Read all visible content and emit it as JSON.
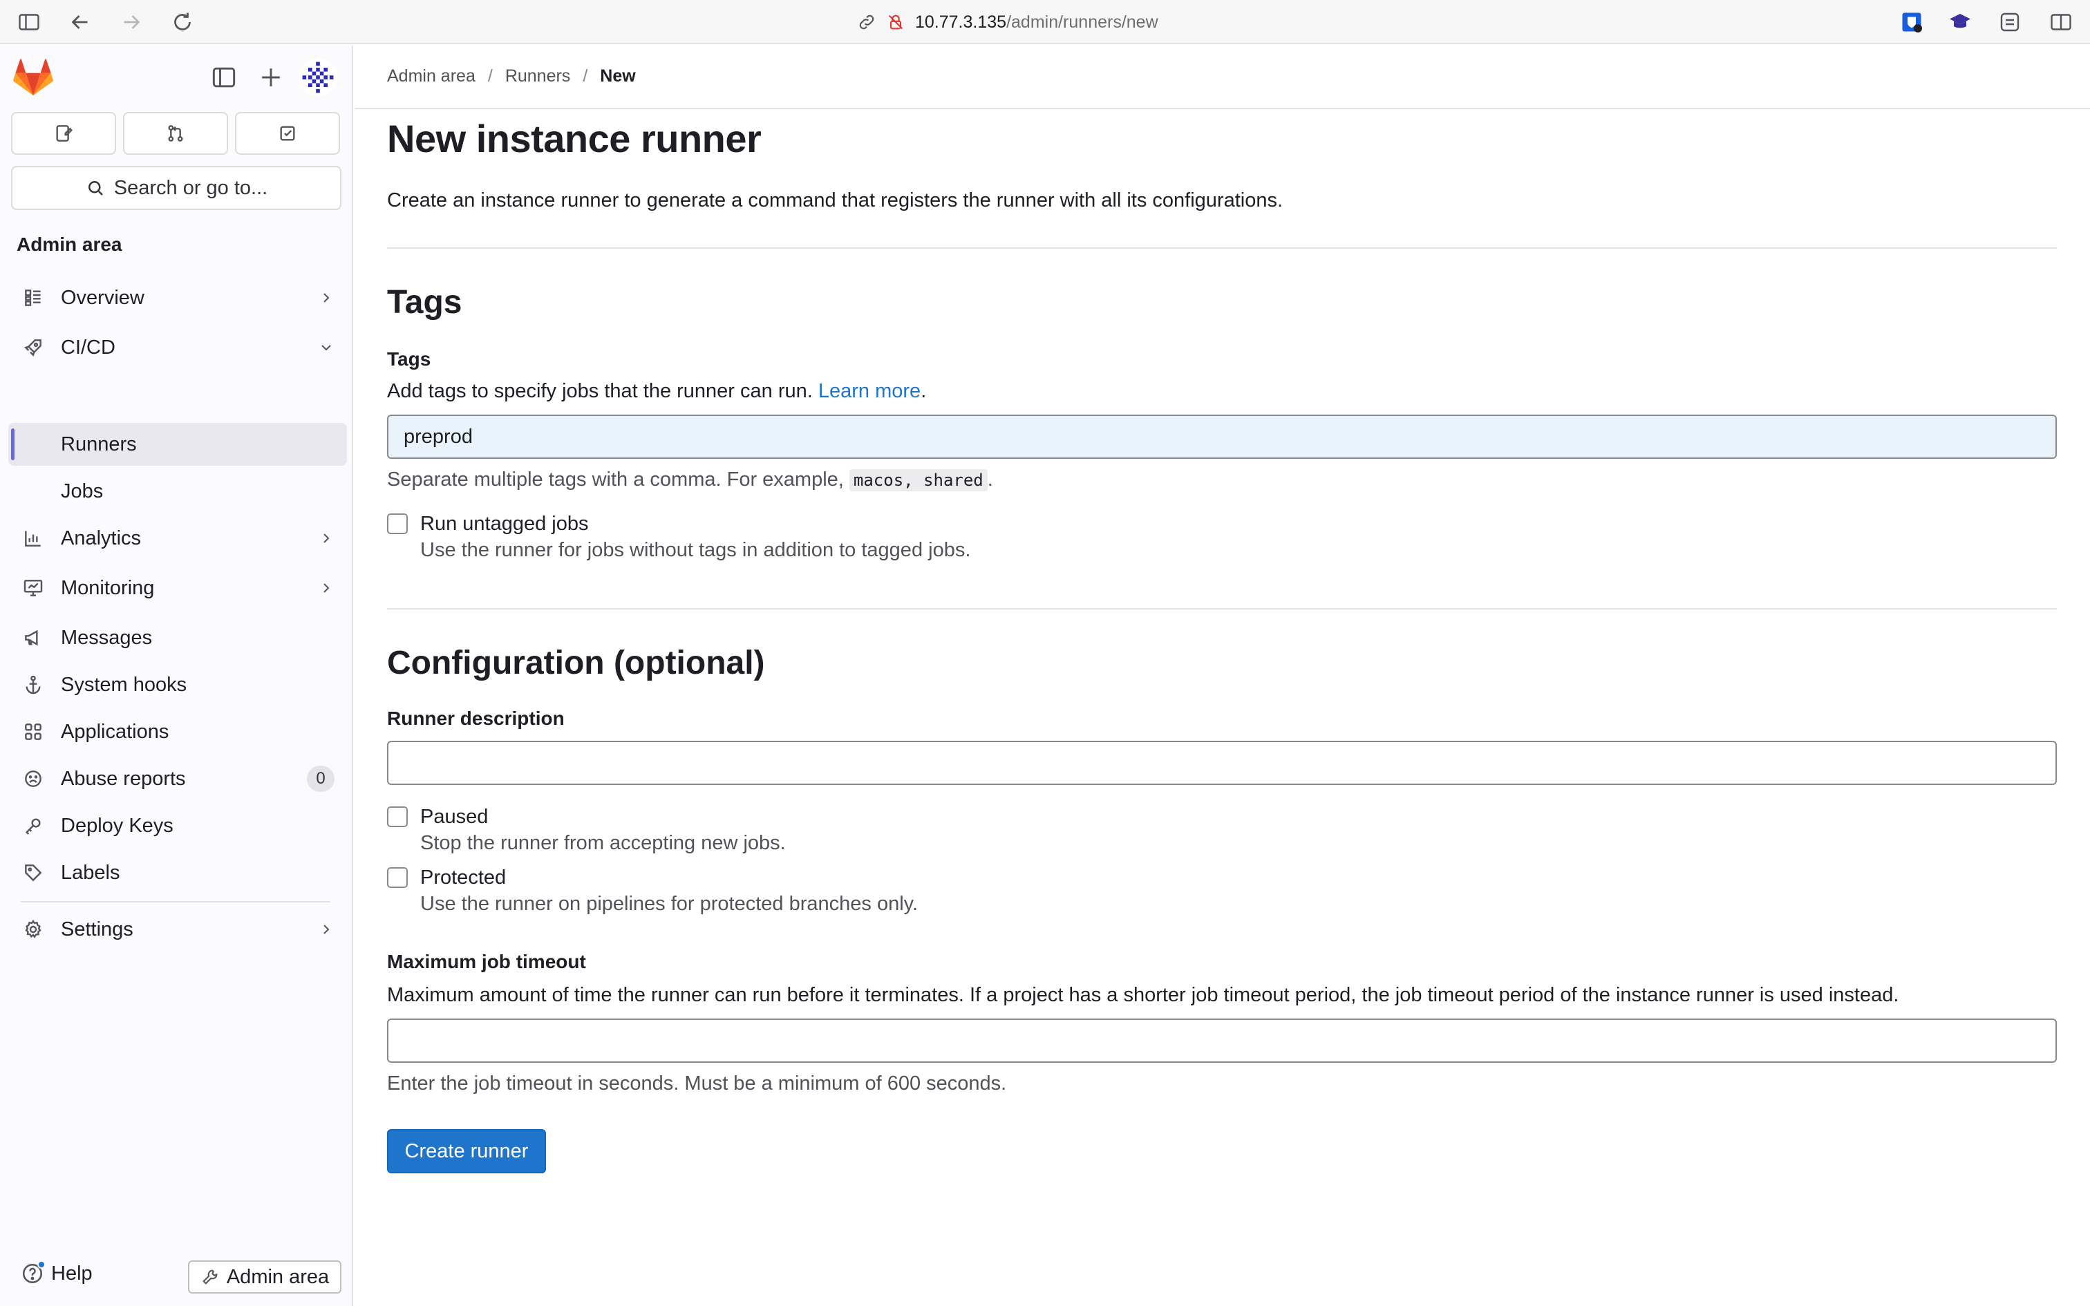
{
  "browser": {
    "url_host": "10.77.3.135",
    "url_path": "/admin/runners/new"
  },
  "sidebar": {
    "search_label": "Search or go to...",
    "section_heading": "Admin area",
    "items": [
      {
        "label": "Overview",
        "icon": "overview-icon"
      },
      {
        "label": "CI/CD",
        "icon": "rocket-icon"
      },
      {
        "label": "Runners"
      },
      {
        "label": "Jobs"
      },
      {
        "label": "Analytics",
        "icon": "chart-icon"
      },
      {
        "label": "Monitoring",
        "icon": "monitor-icon"
      },
      {
        "label": "Messages",
        "icon": "bullhorn-icon"
      },
      {
        "label": "System hooks",
        "icon": "anchor-icon"
      },
      {
        "label": "Applications",
        "icon": "applications-icon"
      },
      {
        "label": "Abuse reports",
        "icon": "abuse-icon",
        "badge": "0"
      },
      {
        "label": "Deploy Keys",
        "icon": "key-icon"
      },
      {
        "label": "Labels",
        "icon": "label-icon"
      },
      {
        "label": "Settings",
        "icon": "settings-icon"
      }
    ],
    "help_label": "Help",
    "admin_button_label": "Admin area"
  },
  "breadcrumb": {
    "items": [
      "Admin area",
      "Runners",
      "New"
    ]
  },
  "page": {
    "title": "New instance runner",
    "description": "Create an instance runner to generate a command that registers the runner with all its configurations."
  },
  "tags_section": {
    "heading": "Tags",
    "field_label": "Tags",
    "help_text": "Add tags to specify jobs that the runner can run.",
    "learn_more": "Learn more",
    "help_suffix": ".",
    "value": "preprod",
    "hint_prefix": "Separate multiple tags with a comma. For example,",
    "hint_code": "macos, shared",
    "hint_suffix": ".",
    "untagged_label": "Run untagged jobs",
    "untagged_help": "Use the runner for jobs without tags in addition to tagged jobs."
  },
  "config_section": {
    "heading": "Configuration (optional)",
    "description_label": "Runner description",
    "description_value": "",
    "paused_label": "Paused",
    "paused_help": "Stop the runner from accepting new jobs.",
    "protected_label": "Protected",
    "protected_help": "Use the runner on pipelines for protected branches only.",
    "timeout_label": "Maximum job timeout",
    "timeout_help": "Maximum amount of time the runner can run before it terminates. If a project has a shorter job timeout period, the job timeout period of the instance runner is used instead.",
    "timeout_value": "",
    "timeout_hint": "Enter the job timeout in seconds. Must be a minimum of 600 seconds."
  },
  "submit_label": "Create runner",
  "colors": {
    "accent": "#1f75cb",
    "sidebar_bg": "#fbfafd",
    "active_item_bg": "#e9e8ee",
    "tag_input_bg": "#e9f3fc"
  }
}
